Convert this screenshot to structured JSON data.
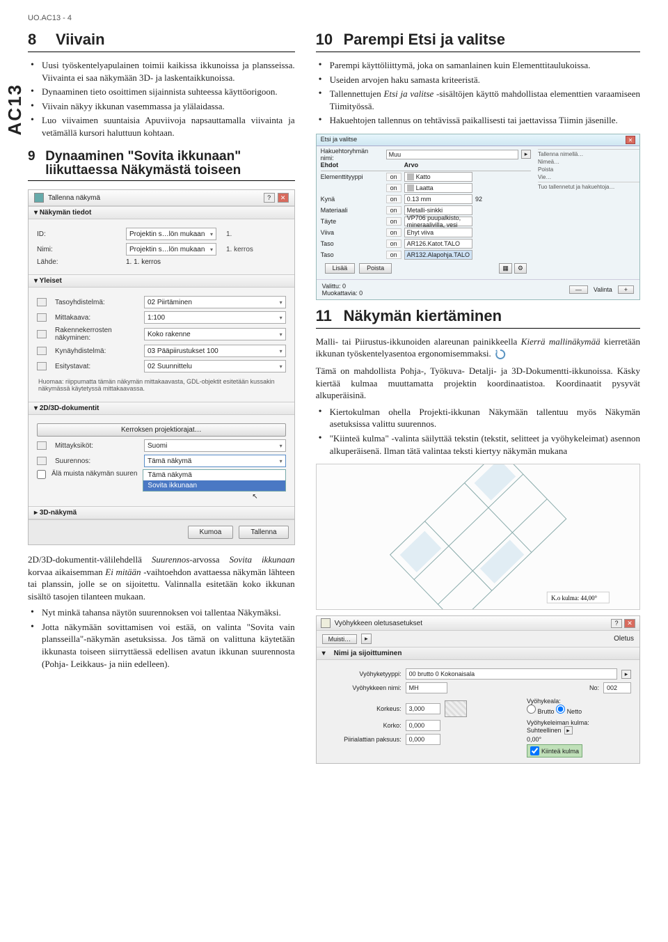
{
  "page_header": "UO.AC13 - 4",
  "side_tab": "AC13",
  "left": {
    "sec8": {
      "num": "8",
      "title": "Viivain",
      "bullets": [
        "Uusi työskentelyapulainen toimii kaikissa ikkunoissa ja plans­seissa. Viivainta ei saa näkymään 3D- ja laskentaikkunoissa.",
        "Dynaaminen tieto osoittimen sijainnista suhteessa käyttöori­goon.",
        "Viivain näkyy ikkunan vasemmassa ja ylälaidassa.",
        "Luo viivaimen suuntaisia Apuviivoja napsauttamalla viivainta ja vetämällä kursori haluttuun kohtaan."
      ]
    },
    "sec9": {
      "num": "9",
      "title": "Dynaaminen \"Sovita ikkunaan\" liikuttaessa Näkymästä toiseen"
    },
    "dialog": {
      "title": "Tallenna näkymä",
      "hdr_info": "Näkymän tiedot",
      "id_label": "ID:",
      "id_value": "Projektin s…lön mukaan",
      "id_after": "1.",
      "name_label": "Nimi:",
      "name_value": "Projektin s…lön mukaan",
      "name_after": "1. kerros",
      "source_label": "Lähde:",
      "source_value": "1. 1. kerros",
      "hdr_general": "Yleiset",
      "tasoyhd_label": "Tasoyhdistelmä:",
      "tasoyhd_value": "02 Piirtäminen",
      "mitt_label": "Mittakaava:",
      "mitt_value": "1:100",
      "rakenne_label": "Rakennekerrosten näkyminen:",
      "rakenne_value": "Koko rakenne",
      "kynayhd_label": "Kynäyhdistelmä:",
      "kynayhd_value": "03 Pääpiirustukset 100",
      "esitys_label": "Esitystavat:",
      "esitys_value": "02 Suunnittelu",
      "note": "Huomaa: riippumatta tämän näkymän mittakaavasta, GDL-objektit esitetään kussakin näkymässä käytetyssä mittakaavassa.",
      "hdr_2d3d": "2D/3D-dokumentit",
      "kerrosproj_btn": "Kerroksen projektiorajat…",
      "mittyks_label": "Mittayksiköt:",
      "mittyks_value": "Suomi",
      "suurennos_label": "Suurennos:",
      "suurennos_value": "Tämä näkymä",
      "check_label": "Älä muista näkymän suuren",
      "combo_opt1": "Tämä näkymä",
      "combo_opt2": "Sovita ikkunaan",
      "hdr_3d": "3D-näkymä",
      "btn_cancel": "Kumoa",
      "btn_save": "Tallenna"
    },
    "para": [
      "2D/3D-dokumentit-välilehdellä <i>Suurennos</i>-arvossa <i>Sovita ikku­naan</i> korvaa aikaisemman <i>Ei mitään</i> -vaihtoehdon avattaessa näkymän lähteen tai planssin, jolle se on sijoitettu. Valinnalla esi­tetään koko ikkunan sisältö tasojen tilanteen mukaan.",
      "Nyt minkä tahansa näytön suurennoksen voi tallentaa Näky­mäksi.",
      "Jotta näkymään sovittamisen voi estää, on valinta \"Sovita vain plansseilla\"-näkymän asetuksissa. Jos tämä on valittuna käy­tetään ikkunasta toiseen siirryttäessä edellisen avatun ikkunan suurennosta (Pohja- Leikkaus- ja niin edelleen)."
    ]
  },
  "right": {
    "sec10": {
      "num": "10",
      "title": "Parempi Etsi ja valitse",
      "bullets": [
        "Parempi käyttöliittymä, joka on samanlainen kuin Elementti­taulukoissa.",
        "Useiden arvojen haku samasta kriteeristä.",
        "Tallennettujen <i>Etsi ja valitse</i> -sisältöjen käyttö mahdollistaa elementtien varaamiseen Tiimityössä.",
        "Hakuehtojen tallennus on tehtävissä paikallisesti tai jaettavissa Tiimin jäsenille."
      ]
    },
    "find": {
      "title": "Etsi ja valitse",
      "group_label": "Hakuehtoryhmän nimi:",
      "group_value": "Muu",
      "col_ehdot": "Ehdot",
      "col_arvo": "Arvo",
      "rows": [
        {
          "c1": "Elementtityyppi",
          "c2": "on",
          "c3": "Katto",
          "icon": "roof-icon"
        },
        {
          "c1": "",
          "c2": "on",
          "c3": "Laatta",
          "icon": "slab-icon"
        },
        {
          "c1": "Kynä",
          "c2": "on",
          "c3": "0.13 mm",
          "c4": "92"
        },
        {
          "c1": "Materiaali",
          "c2": "on",
          "c3": "Metalli-sinkki"
        },
        {
          "c1": "Täyte",
          "c2": "on",
          "c3": "VP706 puupalkisto, mineraalivilla, vesi"
        },
        {
          "c1": "Viiva",
          "c2": "on",
          "c3": "Ehyt viiva"
        },
        {
          "c1": "Taso",
          "c2": "on",
          "c3": "AR126.Katot.TALO"
        },
        {
          "c1": "Taso",
          "c2": "on",
          "c3": "AR132.Alapohja.TALO",
          "blue": true
        }
      ],
      "btn_add": "Lisää",
      "btn_del": "Poista",
      "valittu_label": "Valittu:",
      "valittu_val": "0",
      "muok_label": "Muokattavia:",
      "muok_val": "0",
      "valinta_label": "Valinta",
      "side": [
        "Tallenna nimellä…",
        "Nimeä…",
        "Poista",
        "Vie…",
        "Tuo tallennetut ja hakuehtoja…"
      ]
    },
    "sec11": {
      "num": "11",
      "title": "Näkymän kiertäminen",
      "p1": "Malli- tai Piirustus-ikkunoiden alareunan painikkeella <i>Kierrä mallinäkymää</i> kierretään ikkunan työskentely­asentoa ergonomisemmaksi.",
      "p2": "Tämä on mahdollista Pohja-, Työkuva- Detalji- ja 3D-Doku­mentti-ikkunoissa. Käsky kiertää kulmaa muuttamatta projektin koordinaatistoa. Koordinaatit pysyvät alkuperäisinä.",
      "b1": "Kiertokulman ohella Projekti-ikkunan Näkymään tallentuu myös Näkymän asetuksissa valittu suurennos.",
      "b2": "\"Kiinteä kulma\" -valinta säilyttää tekstin (tekstit, selitteet ja vyöhykeleimat) asennon alkuperäisenä. Ilman tätä valintaa teksti kiertyy näkymän mukana"
    },
    "floor_caption": "K.o kulma: 44,00°",
    "zone": {
      "title": "Vyöhykkeen oletusasetukset",
      "muisti": "Muisti…",
      "oletus": "Oletus",
      "hdr": "Nimi ja sijoittuminen",
      "typ_label": "Vyöhyketyyppi:",
      "typ_value": "00 brutto   0 Kokonaisala",
      "name_label": "Vyöhykkeen nimi:",
      "name_value": "MH",
      "no_label": "No:",
      "no_value": "002",
      "korkeus_label": "Korkeus:",
      "korkeus_value": "3,000",
      "korko_label": "Korko:",
      "korko_value": "0,000",
      "pinn_label": "Piirialattian paksuus:",
      "pinn_value": "0,000",
      "vyala_label": "Vyöhykeala:",
      "brutto": "Brutto",
      "netto": "Netto",
      "kulma_label": "Vyöhykeleiman kulma:",
      "suht": "Suhteellinen",
      "kulma_value": "0,00°",
      "kiintea": "Kiinteä kulma"
    }
  }
}
